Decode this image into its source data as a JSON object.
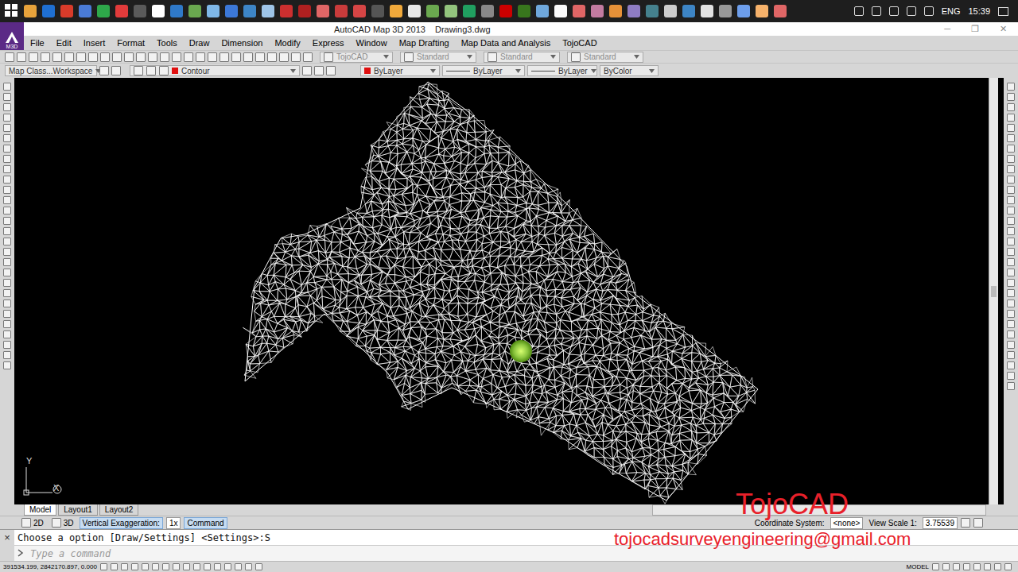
{
  "taskbar": {
    "language": "ENG",
    "clock": "15:39"
  },
  "window": {
    "title": "AutoCAD Map 3D 2013",
    "document": "Drawing3.dwg",
    "controls": [
      "─",
      "❐",
      "✕"
    ]
  },
  "app_logo": "M3D",
  "menu": [
    "File",
    "Edit",
    "Insert",
    "Format",
    "Tools",
    "Draw",
    "Dimension",
    "Modify",
    "Express",
    "Window",
    "Map Drafting",
    "Map Data and Analysis",
    "TojoCAD"
  ],
  "toolbar": {
    "dropdowns": [
      {
        "label": "TojoCAD",
        "disabled": true
      },
      {
        "label": "Standard",
        "disabled": true
      },
      {
        "label": "Standard",
        "disabled": true
      },
      {
        "label": "Standard",
        "disabled": true
      }
    ]
  },
  "properties": {
    "workspace": "Map Class...Workspace",
    "layer": "Contour",
    "color": "ByLayer",
    "linetype": "ByLayer",
    "lineweight": "ByLayer",
    "plot_style": "ByColor"
  },
  "ucs": {
    "y": "Y",
    "x": "X"
  },
  "layout_tabs": [
    {
      "label": "Model",
      "selected": true
    },
    {
      "label": "Layout1",
      "selected": false
    },
    {
      "label": "Layout2",
      "selected": false
    }
  ],
  "status": {
    "mode_2d": "2D",
    "mode_3d": "3D",
    "exaggeration_label": "Vertical Exaggeration:",
    "exaggeration": "1x",
    "command_button": "Command",
    "coord_system_label": "Coordinate System:",
    "coord_system": "<none>",
    "view_scale_label": "View Scale 1:",
    "view_scale": "3.75539"
  },
  "command_line": {
    "close": "×",
    "history": "Choose a option [Draw/Settings] <Settings>:S",
    "placeholder": "Type a command"
  },
  "status_bar": {
    "coordinates": "391534.199, 2842170.897, 0.000",
    "space": "MODEL"
  },
  "watermark": {
    "brand": "TojoCAD",
    "email": "tojocadsurveyengineering@gmail.com"
  }
}
